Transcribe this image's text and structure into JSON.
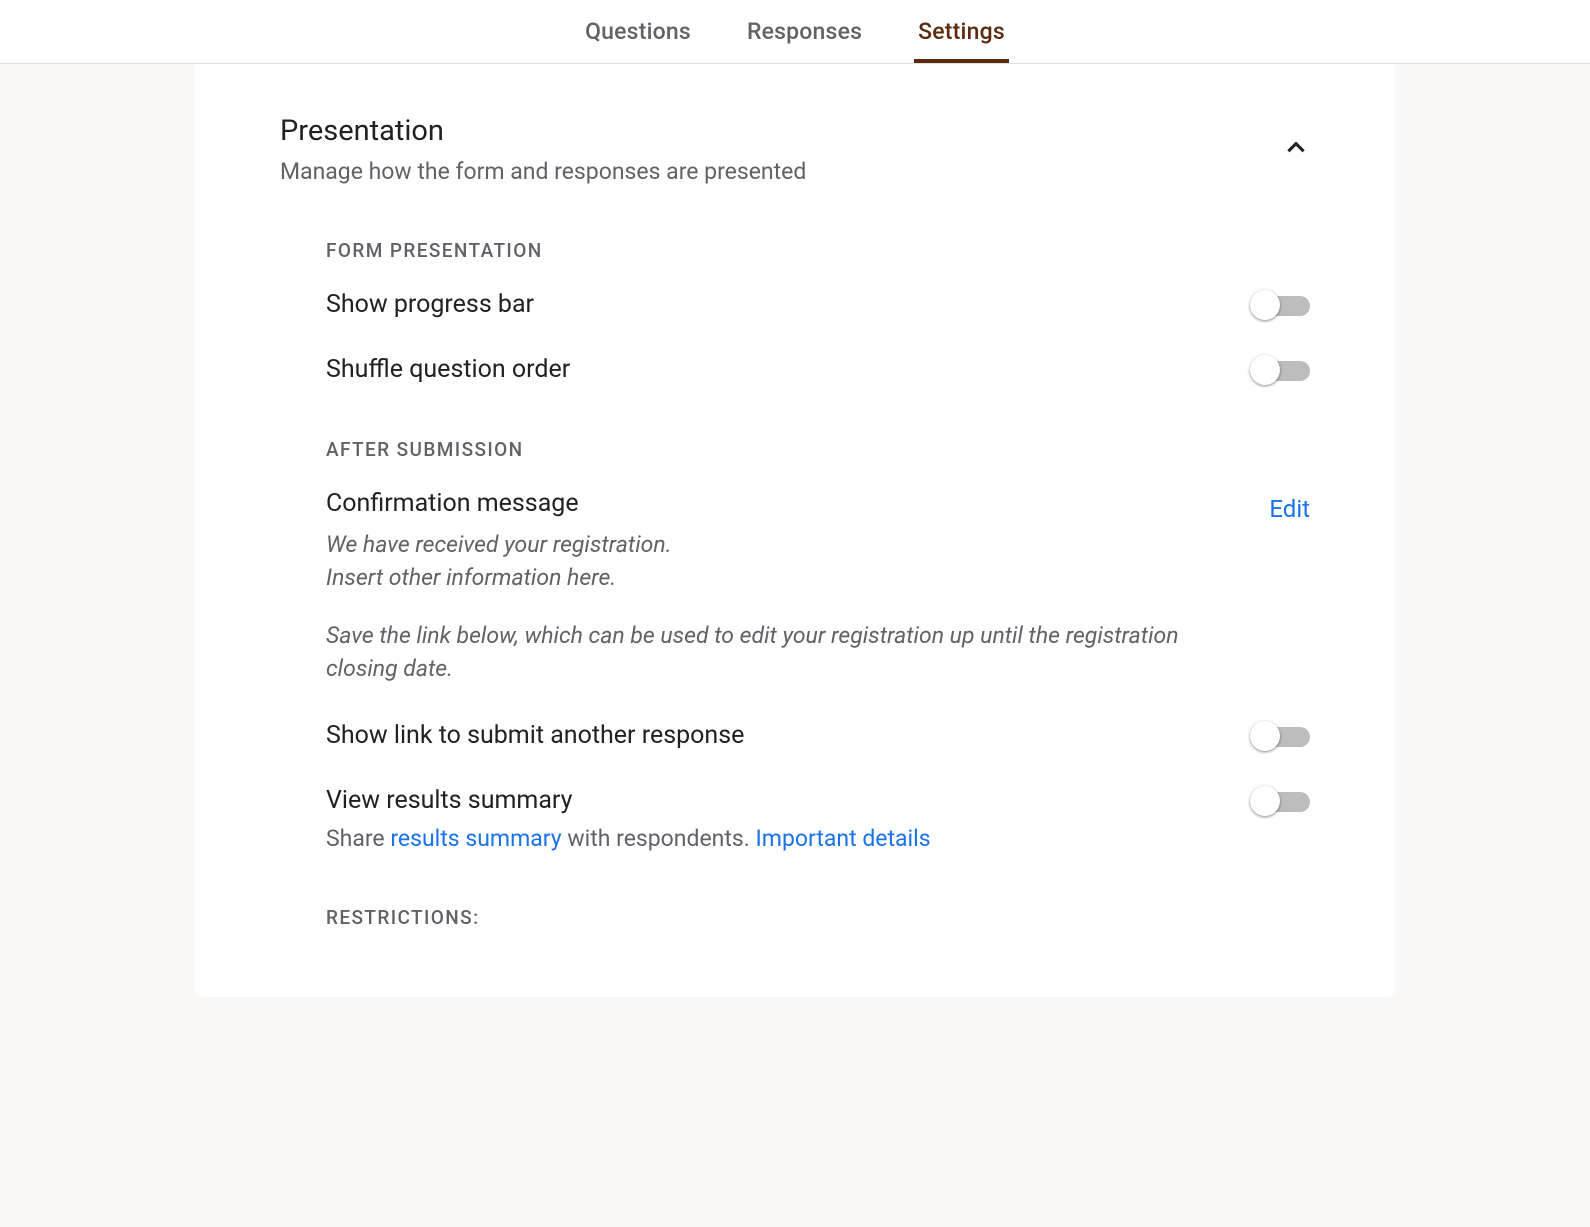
{
  "tabs": {
    "questions": "Questions",
    "responses": "Responses",
    "settings": "Settings"
  },
  "section": {
    "title": "Presentation",
    "subtitle": "Manage how the form and responses are presented"
  },
  "groups": {
    "form_presentation": {
      "label": "Form presentation",
      "progress_bar": "Show progress bar",
      "shuffle": "Shuffle question order"
    },
    "after_submission": {
      "label": "After submission",
      "confirmation": {
        "title": "Confirmation message",
        "line1": "We have received your registration.",
        "line2": "Insert other information here.",
        "line3": "Save the link below, which can be used to edit your registration up until the registration closing date.",
        "edit": "Edit"
      },
      "submit_another": "Show link to submit another response",
      "results": {
        "title": "View results summary",
        "pre": "Share ",
        "link1": "results summary",
        "mid": " with respondents. ",
        "link2": "Important details"
      }
    },
    "restrictions": {
      "label": "Restrictions:"
    }
  }
}
